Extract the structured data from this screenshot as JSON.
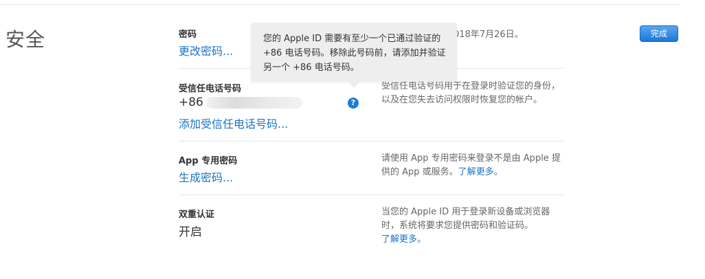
{
  "header": {
    "title": "安全",
    "done_button": "完成"
  },
  "password": {
    "label": "密码",
    "link": "更改密码...",
    "date_text_visible": "018年7月26日。"
  },
  "trusted_phone": {
    "label": "受信任电话号码",
    "country_code": "+86",
    "add_link": "添加受信任电话号码...",
    "description": "受信任电话号码用于在登录时验证您的身份，以及在您失去访问权限时恢复您的帐户。",
    "help_icon_glyph": "?"
  },
  "tooltip": {
    "text": "您的 Apple ID 需要有至少一个已通过验证的 +86 电话号码。移除此号码前，请添加并验证另一个 +86 电话号码。"
  },
  "app_password": {
    "label": "App 专用密码",
    "link": "生成密码...",
    "description": "请使用 App 专用密码来登录不是由 Apple 提供的 App 或服务。",
    "learn_more": "了解更多。"
  },
  "two_factor": {
    "label": "双重认证",
    "status": "开启",
    "description": "当您的 Apple ID 用于登录新设备或浏览器时，系统将要求您提供密码和验证码。",
    "learn_more": "了解更多。"
  },
  "colors": {
    "accent": "#1a73c7",
    "button": "#1c76d8",
    "tooltip_bg": "#eeeeee"
  }
}
